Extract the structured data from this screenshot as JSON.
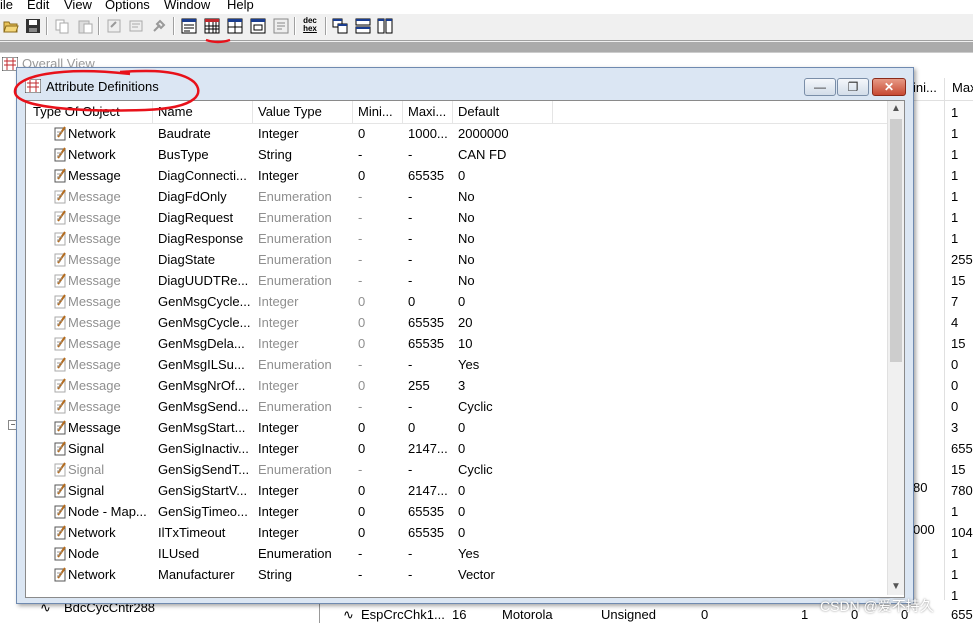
{
  "menu": [
    "ile",
    "Edit",
    "View",
    "Options",
    "Window",
    "Help"
  ],
  "toolbar": {
    "icons": [
      "open-icon",
      "save-icon",
      "copy-icon",
      "paste-icon",
      "properties-icon",
      "edit-icon",
      "tool-icon",
      "overview-icon",
      "attribute-table-icon",
      "table-icon",
      "window-icon",
      "window-alt-icon",
      "dec-hex-icon",
      "cascade-icon",
      "tile-horizontal-icon",
      "tile-vertical-icon"
    ],
    "dec_label": "dec",
    "hex_label": "hex"
  },
  "background_window": {
    "title": "Overall View",
    "header_min": "ini...",
    "header_max": "Max",
    "max_values": [
      "1",
      "1",
      "1",
      "1",
      "1",
      "1",
      "1",
      "255",
      "15",
      "7",
      "4",
      "15",
      "0",
      "0",
      "0",
      "3",
      "655",
      "15",
      "780",
      "1",
      "104",
      "1",
      "1",
      "1"
    ],
    "min_fragments": {
      "row19": "80",
      "row21": "000"
    },
    "bottom_left_text": "BdcCycCntr288",
    "bottom_row": {
      "name": "EspCrcChk1...",
      "length": "16",
      "byte_order": "Motorola",
      "value_type": "Unsigned",
      "initial": "0",
      "factor": "1",
      "offset": "0",
      "minimum": "0",
      "maximum": "655"
    }
  },
  "dialog": {
    "title": "Attribute Definitions",
    "buttons": {
      "minimize": "—",
      "restore": "❐",
      "close": "✕"
    },
    "columns": [
      "Type Of Object",
      "Name",
      "Value Type",
      "Mini...",
      "Maxi...",
      "Default"
    ],
    "rows": [
      {
        "type": "Network",
        "name": "Baudrate",
        "value_type": "Integer",
        "min": "0",
        "max": "1000...",
        "default": "2000000",
        "dim": false
      },
      {
        "type": "Network",
        "name": "BusType",
        "value_type": "String",
        "min": "-",
        "max": "-",
        "default": "CAN FD",
        "dim": false
      },
      {
        "type": "Message",
        "name": "DiagConnecti...",
        "value_type": "Integer",
        "min": "0",
        "max": "65535",
        "default": "0",
        "dim": false
      },
      {
        "type": "Message",
        "name": "DiagFdOnly",
        "value_type": "Enumeration",
        "min": "-",
        "max": "-",
        "default": "No",
        "dim": true
      },
      {
        "type": "Message",
        "name": "DiagRequest",
        "value_type": "Enumeration",
        "min": "-",
        "max": "-",
        "default": "No",
        "dim": true
      },
      {
        "type": "Message",
        "name": "DiagResponse",
        "value_type": "Enumeration",
        "min": "-",
        "max": "-",
        "default": "No",
        "dim": true
      },
      {
        "type": "Message",
        "name": "DiagState",
        "value_type": "Enumeration",
        "min": "-",
        "max": "-",
        "default": "No",
        "dim": true
      },
      {
        "type": "Message",
        "name": "DiagUUDTRe...",
        "value_type": "Enumeration",
        "min": "-",
        "max": "-",
        "default": "No",
        "dim": true
      },
      {
        "type": "Message",
        "name": "GenMsgCycle...",
        "value_type": "Integer",
        "min": "0",
        "max": "0",
        "default": "0",
        "dim": true
      },
      {
        "type": "Message",
        "name": "GenMsgCycle...",
        "value_type": "Integer",
        "min": "0",
        "max": "65535",
        "default": "20",
        "dim": true
      },
      {
        "type": "Message",
        "name": "GenMsgDela...",
        "value_type": "Integer",
        "min": "0",
        "max": "65535",
        "default": "10",
        "dim": true
      },
      {
        "type": "Message",
        "name": "GenMsgILSu...",
        "value_type": "Enumeration",
        "min": "-",
        "max": "-",
        "default": "Yes",
        "dim": true
      },
      {
        "type": "Message",
        "name": "GenMsgNrOf...",
        "value_type": "Integer",
        "min": "0",
        "max": "255",
        "default": "3",
        "dim": true
      },
      {
        "type": "Message",
        "name": "GenMsgSend...",
        "value_type": "Enumeration",
        "min": "-",
        "max": "-",
        "default": "Cyclic",
        "dim": true
      },
      {
        "type": "Message",
        "name": "GenMsgStart...",
        "value_type": "Integer",
        "min": "0",
        "max": "0",
        "default": "0",
        "dim": false
      },
      {
        "type": "Signal",
        "name": "GenSigInactiv...",
        "value_type": "Integer",
        "min": "0",
        "max": "2147...",
        "default": "0",
        "dim": false
      },
      {
        "type": "Signal",
        "name": "GenSigSendT...",
        "value_type": "Enumeration",
        "min": "-",
        "max": "-",
        "default": "Cyclic",
        "dim": true
      },
      {
        "type": "Signal",
        "name": "GenSigStartV...",
        "value_type": "Integer",
        "min": "0",
        "max": "2147...",
        "default": "0",
        "dim": false
      },
      {
        "type": "Node - Map...",
        "name": "GenSigTimeo...",
        "value_type": "Integer",
        "min": "0",
        "max": "65535",
        "default": "0",
        "dim": false
      },
      {
        "type": "Network",
        "name": "IlTxTimeout",
        "value_type": "Integer",
        "min": "0",
        "max": "65535",
        "default": "0",
        "dim": false
      },
      {
        "type": "Node",
        "name": "ILUsed",
        "value_type": "Enumeration",
        "min": "-",
        "max": "-",
        "default": "Yes",
        "dim": false
      },
      {
        "type": "Network",
        "name": "Manufacturer",
        "value_type": "String",
        "min": "-",
        "max": "-",
        "default": "Vector",
        "dim": false
      }
    ]
  },
  "watermark": "CSDN @爱不持久",
  "colors": {
    "annotation": "#e8111a",
    "dim_text": "#8f8f8f",
    "dialog_frame": "#dbe6f3"
  }
}
